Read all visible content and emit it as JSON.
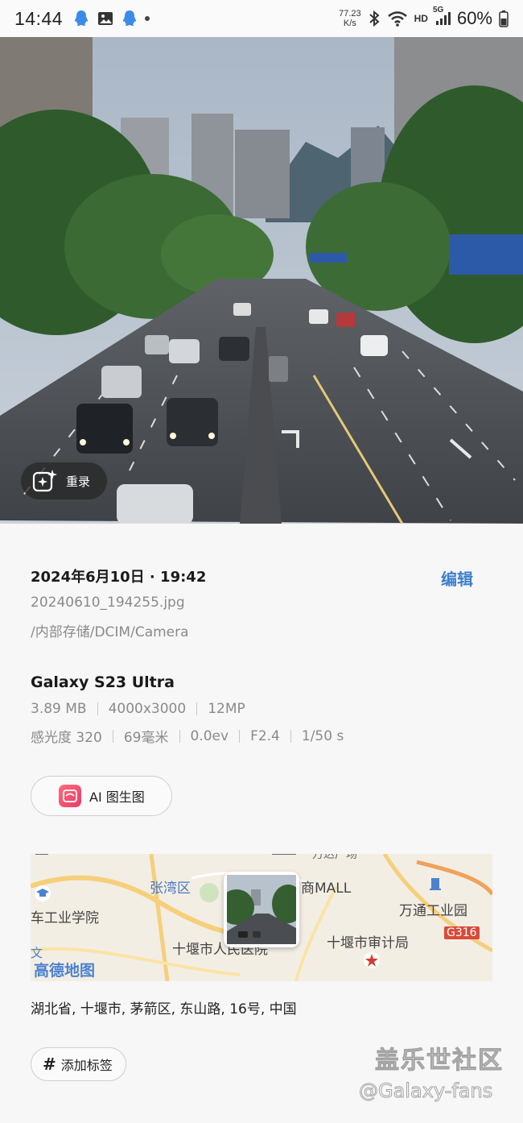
{
  "status_bar": {
    "time": "14:44",
    "speed_value": "77.23",
    "speed_unit": "K/s",
    "hd": "HD",
    "network": "5G",
    "battery": "60%"
  },
  "photo": {
    "remaster_label": "重录"
  },
  "details": {
    "date": "2024年6月10日 · 19:42",
    "edit_label": "编辑",
    "filename": "20240610_194255.jpg",
    "path": "/内部存储/DCIM/Camera",
    "device": "Galaxy S23 Ultra",
    "specs_row1": [
      "3.89 MB",
      "4000x3000",
      "12MP"
    ],
    "specs_row2": [
      "感光度 320",
      "69毫米",
      "0.0ev",
      "F2.4",
      "1/50 s"
    ],
    "ai_button_label": "AI 图生图",
    "address": "湖北省, 十堰市, 茅箭区, 东山路, 16号, 中国",
    "add_tag_label": "添加标签"
  },
  "map": {
    "labels": {
      "zhangwan": "张湾区",
      "mall": "商MALL",
      "wantong": "万通工业园",
      "college": "车工业学院",
      "shiyan": "十堰市人民医院",
      "audit": "十堰市审计局",
      "route": "G316",
      "provider": "高德地图",
      "top_a": "万达广场",
      "top_b": "文"
    }
  },
  "watermark": {
    "line1": "盖乐世社区",
    "line2": "@Galaxy-fans"
  },
  "colors": {
    "accent": "#3d7fd0",
    "secondary_text": "#8a8a8a",
    "background": "#f7f7f7"
  }
}
